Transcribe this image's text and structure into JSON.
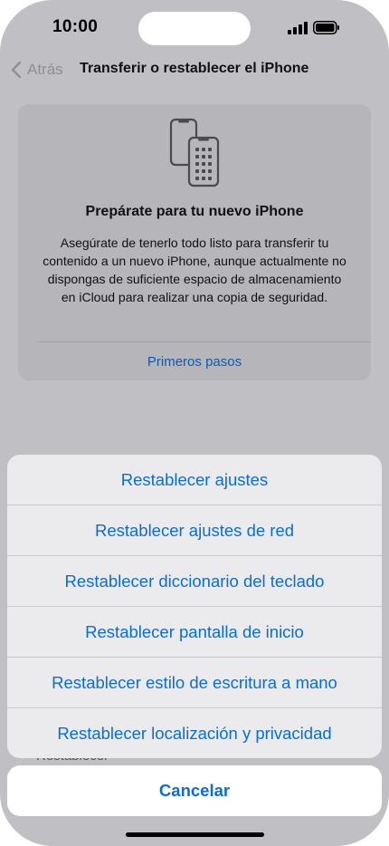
{
  "status_bar": {
    "time": "10:00"
  },
  "nav": {
    "back_label": "Atrás",
    "title": "Transferir o restablecer el iPhone"
  },
  "card": {
    "title": "Prepárate para tu nuevo iPhone",
    "body": "Asegúrate de tenerlo todo listo para transferir tu contenido a un nuevo iPhone, aunque actualmente no dispongas de suficiente espacio de almacenamiento en iCloud para realizar una copia de seguridad.",
    "link": "Primeros pasos"
  },
  "background_item": "Restablecer",
  "sheet": {
    "actions": [
      "Restablecer ajustes",
      "Restablecer ajustes de red",
      "Restablecer diccionario del teclado",
      "Restablecer pantalla de inicio",
      "Restablecer estilo de escritura a mano",
      "Restablecer localización y privacidad"
    ],
    "cancel": "Cancelar"
  },
  "colors": {
    "accent": "#0a6dd4",
    "dim_background": "#bfbfc4",
    "sheet": "#ebebed"
  }
}
